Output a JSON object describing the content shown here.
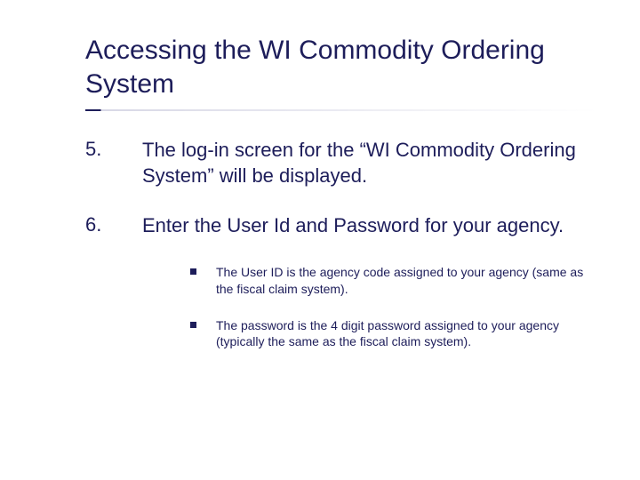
{
  "title": "Accessing the WI Commodity Ordering System",
  "steps": [
    {
      "number": "5.",
      "text": "The log-in screen for the “WI Commodity Ordering System” will be displayed."
    },
    {
      "number": "6.",
      "text": "Enter the User Id and Password for your agency."
    }
  ],
  "subbullets": [
    "The User ID is the agency code assigned to your agency (same as the fiscal claim system).",
    "The password is the 4 digit password assigned to your agency (typically the same as the fiscal claim system)."
  ]
}
